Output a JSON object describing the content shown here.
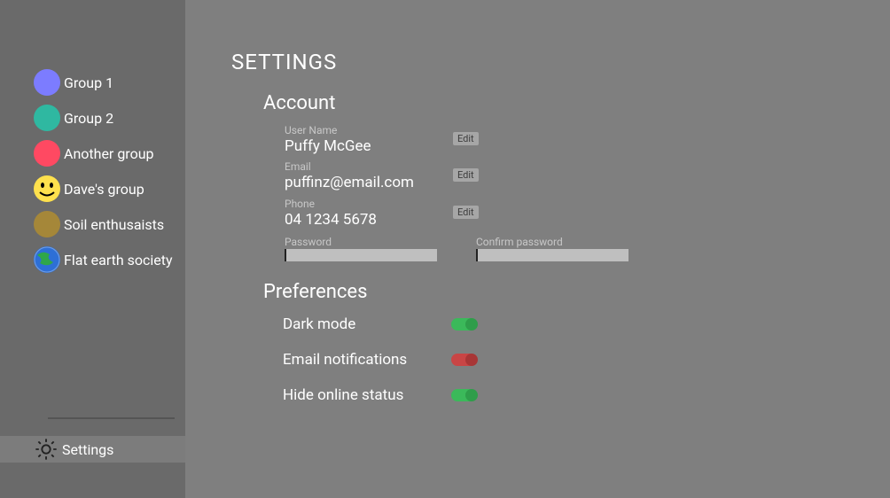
{
  "sidebar": {
    "groups": [
      {
        "label": "Group 1",
        "color": "#7c7cff"
      },
      {
        "label": "Group 2",
        "color": "#2fb8a1"
      },
      {
        "label": "Another group",
        "color": "#ff4962"
      },
      {
        "label": "Dave's group",
        "color": "smiley"
      },
      {
        "label": "Soil enthusaists",
        "color": "#a58739"
      },
      {
        "label": "Flat earth society",
        "color": "earth"
      }
    ],
    "settings_label": "Settings"
  },
  "page": {
    "title": "SETTINGS",
    "sections": {
      "account": {
        "title": "Account",
        "fields": {
          "username": {
            "label": "User Name",
            "value": "Puffy McGee",
            "edit": "Edit"
          },
          "email": {
            "label": "Email",
            "value": "puffinz@email.com",
            "edit": "Edit"
          },
          "phone": {
            "label": "Phone",
            "value": "04 1234 5678",
            "edit": "Edit"
          },
          "password_label": "Password",
          "confirm_password_label": "Confirm password"
        }
      },
      "preferences": {
        "title": "Preferences",
        "items": [
          {
            "label": "Dark mode",
            "on": true
          },
          {
            "label": "Email notifications",
            "on": false
          },
          {
            "label": "Hide online status",
            "on": true
          }
        ]
      }
    }
  }
}
